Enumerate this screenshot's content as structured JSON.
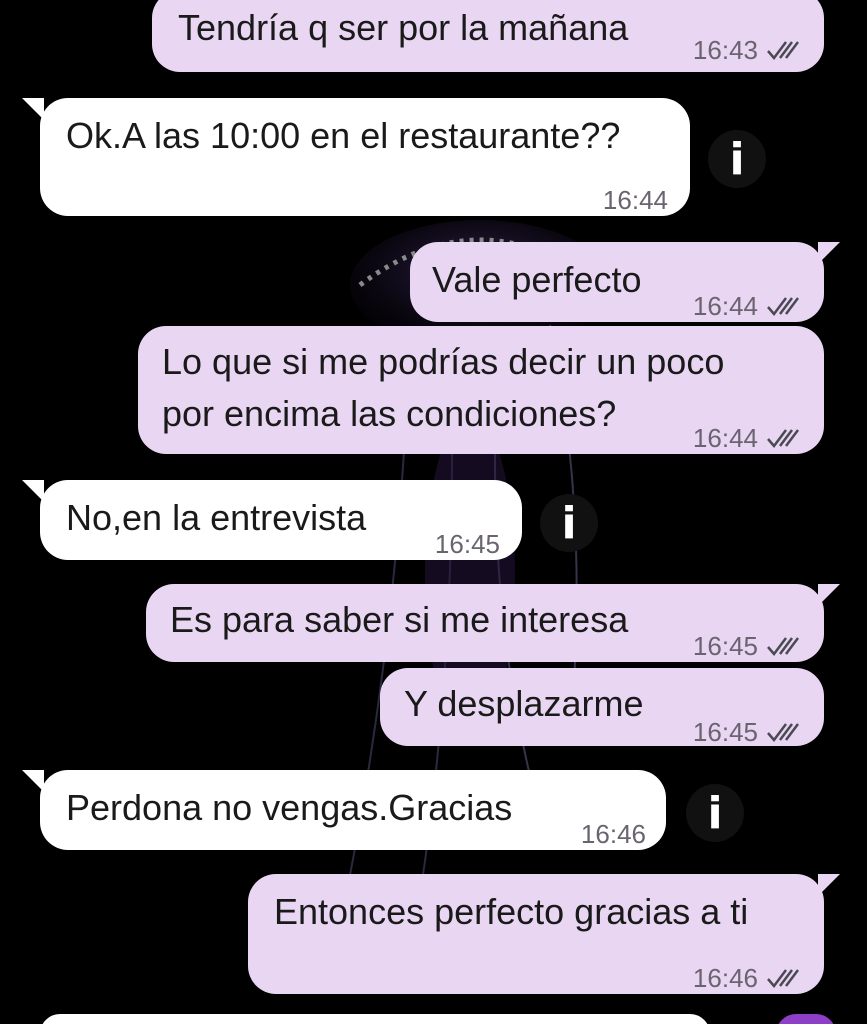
{
  "colors": {
    "background": "#000000",
    "outgoing_bubble": "#e9d6f2",
    "incoming_bubble": "#ffffff",
    "meta_text": "#6a6470"
  },
  "messages": [
    {
      "direction": "out",
      "text": "Tendría q ser por la mañana",
      "time": "16:43",
      "read_ticks": "double-check-icon"
    },
    {
      "direction": "in",
      "text": "Ok.A las 10:00 en el restaurante??",
      "time": "16:44",
      "info_icon": "info-icon"
    },
    {
      "direction": "out",
      "text": "Vale perfecto",
      "time": "16:44",
      "read_ticks": "double-check-icon"
    },
    {
      "direction": "out",
      "text_lines": [
        "Lo que si me podrías decir un poco",
        "por encima las condiciones?"
      ],
      "time": "16:44",
      "read_ticks": "double-check-icon"
    },
    {
      "direction": "in",
      "text": "No,en la entrevista",
      "time": "16:45",
      "info_icon": "info-icon"
    },
    {
      "direction": "out",
      "text": "Es para saber si me interesa",
      "time": "16:45",
      "read_ticks": "double-check-icon"
    },
    {
      "direction": "out",
      "text": "Y desplazarme",
      "time": "16:45",
      "read_ticks": "double-check-icon"
    },
    {
      "direction": "in",
      "text": "Perdona no vengas.Gracias",
      "time": "16:46",
      "info_icon": "info-icon"
    },
    {
      "direction": "out",
      "text": "Entonces perfecto gracias a ti",
      "time": "16:46",
      "read_ticks": "double-check-icon"
    }
  ],
  "info_glyph": "i"
}
